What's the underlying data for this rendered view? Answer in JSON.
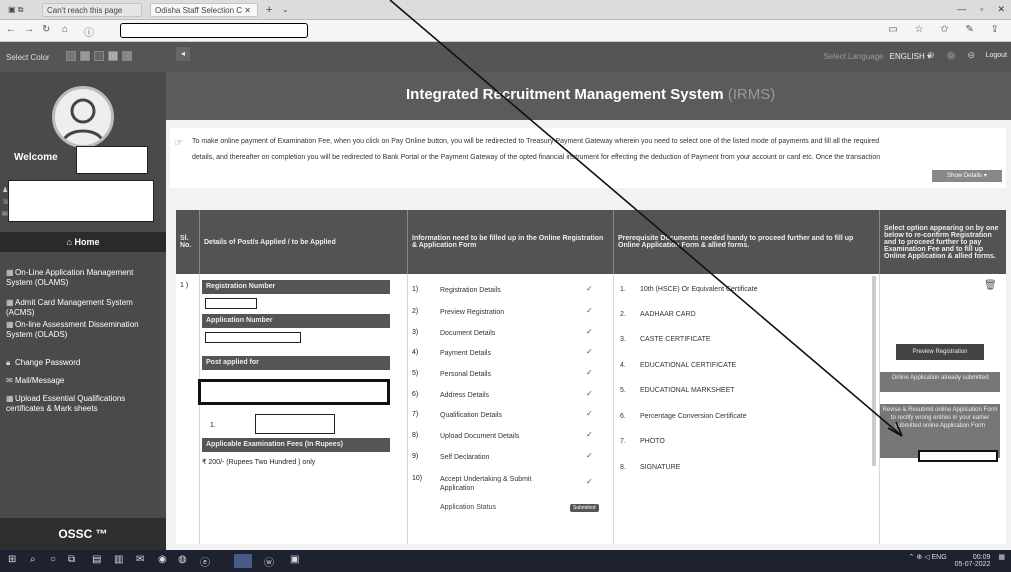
{
  "browser": {
    "tab1": "Can't reach this page",
    "tab2": "Odisha Staff Selection C",
    "new_tab": "+"
  },
  "topbar": {
    "select_color": "Select Color",
    "lang_prefix": "Select Language",
    "lang": "ENGLISH",
    "logout": "Logout"
  },
  "sidebar": {
    "welcome": "Welcome",
    "home": "Home",
    "items": [
      "On-Line Application Management System (OLAMS)",
      "Admit Card Management System (ACMS)",
      "On-line Assessment Dissemination System (OLADS)",
      "Change Password",
      "Mail/Message",
      "Upload Essential Qualifications certificates & Mark sheets"
    ],
    "footer": "OSSC ™"
  },
  "main": {
    "title": "Integrated Recruitment Management System",
    "title_suffix": "(IRMS)",
    "notice_line1": "To make online payment of Examination Fee, when you click on Pay Online button, you will be redirected to Treasury Payment Gateway wherein you need to select one of the listed mode of payments and fill all the required",
    "notice_line2": "details, and thereafter on completion you will be redirected to Bank Portal or the Payment Gateway of the opted financial instrument for effecting the deduction of Payment from your account or card etc. Once the transaction",
    "show_details": "Show Details"
  },
  "table": {
    "headers": [
      "Sl. No.",
      "Details of Post/s Applied / to be Applied",
      "Information need to be filled up in the Online Registration & Application Form",
      "Prerequisite Documents needed handy to proceed further and to fill up Online Application Form & allied forms.",
      "Select option appearing on by one below to re-confirm Registration and to proceed further to pay Examination Fee and to fill up Online Application & allied forms."
    ],
    "row_sl": "1 )",
    "registration_number": "Registration Number",
    "application_number": "Application Number",
    "post_applied_for": "Post applied for",
    "post_index": "1.",
    "fees_label": "Applicable Examination Fees (In Rupees)",
    "fees_value": "₹ 200/- (Rupees Two Hundred ) only",
    "steps": [
      {
        "n": "1)",
        "label": "Registration Details"
      },
      {
        "n": "2)",
        "label": "Preview Registration"
      },
      {
        "n": "3)",
        "label": "Document Details"
      },
      {
        "n": "4)",
        "label": "Payment Details"
      },
      {
        "n": "5)",
        "label": "Personal Details"
      },
      {
        "n": "6)",
        "label": "Address Details"
      },
      {
        "n": "7)",
        "label": "Qualification Details"
      },
      {
        "n": "8)",
        "label": "Upload Document Details"
      },
      {
        "n": "9)",
        "label": "Self Declaration"
      },
      {
        "n": "10)",
        "label": "Accept Undertaking & Submit Application"
      }
    ],
    "application_status_label": "Application Status",
    "application_status_badge": "Submitted",
    "documents": [
      {
        "n": "1.",
        "label": "10th (HSCE) Or Equivalent Certificate"
      },
      {
        "n": "2.",
        "label": "AADHAAR CARD"
      },
      {
        "n": "3.",
        "label": "CASTE CERTIFICATE"
      },
      {
        "n": "4.",
        "label": "EDUCATIONAL CERTIFICATE"
      },
      {
        "n": "5.",
        "label": "EDUCATIONAL MARKSHEET"
      },
      {
        "n": "6.",
        "label": "Percentage Conversion Certificate"
      },
      {
        "n": "7.",
        "label": "PHOTO"
      },
      {
        "n": "8.",
        "label": "SIGNATURE"
      }
    ],
    "btn_preview": "Preview Registration",
    "btn_submitted": "Online Application already submitted",
    "btn_revise": "Revise & Resubmit online Application Form to rectify wrong entries in your earlier submitted online Application Form"
  },
  "taskbar": {
    "tray_lang": "ENG",
    "time": "00:09",
    "date": "05-07-2022"
  }
}
